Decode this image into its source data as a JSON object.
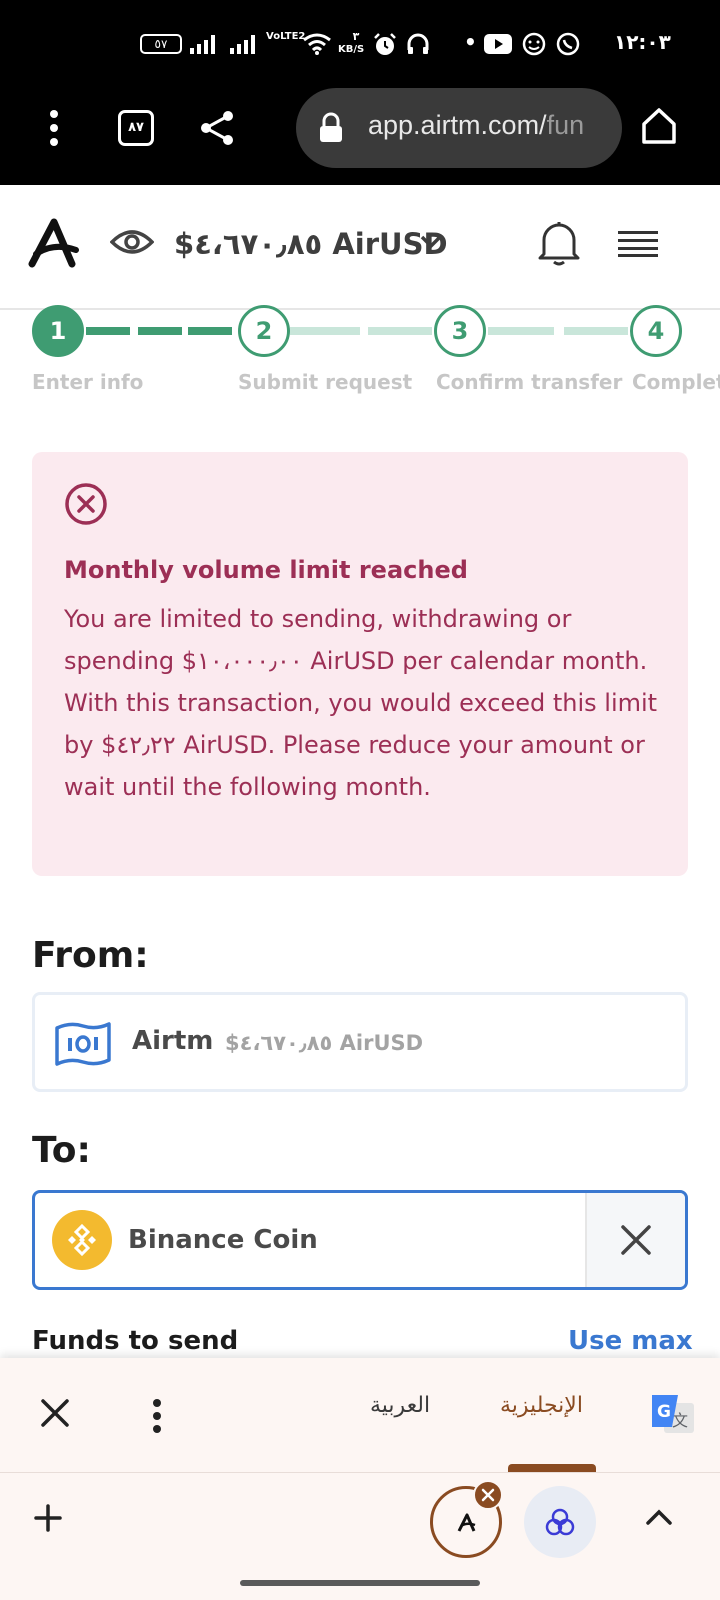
{
  "status_bar": {
    "battery": "٥٧",
    "network_label": "VoLTE2",
    "speed_value": "٣",
    "speed_unit": "KB/S",
    "time": "١٢:٠٣"
  },
  "browser": {
    "tab_count": "٨٧",
    "url_main": "app.airtm.com/",
    "url_faded": "fun"
  },
  "header": {
    "balance": "$٤،٦٧٠٫٨٥ AirUSD"
  },
  "stepper": {
    "steps": [
      {
        "number": "1",
        "label": "Enter info"
      },
      {
        "number": "2",
        "label": "Submit request"
      },
      {
        "number": "3",
        "label": "Confirm transfer"
      },
      {
        "number": "4",
        "label": "Complete"
      }
    ],
    "current_step": 1
  },
  "alert": {
    "title": "Monthly volume limit reached",
    "body": "You are limited to sending, withdrawing or spending $١٠،٠٠٠٫٠٠ AirUSD per calendar month. With this transaction, you would exceed this limit by $٤٢٫٢٢ AirUSD. Please reduce your amount or wait until the following month."
  },
  "from": {
    "label": "From:",
    "name": "Airtm",
    "balance": "$٤،٦٧٠٫٨٥ AirUSD"
  },
  "to": {
    "label": "To:",
    "name": "Binance Coin"
  },
  "funds": {
    "label": "Funds to send",
    "use_max": "Use max"
  },
  "translate": {
    "source_language": "العربية",
    "target_language": "الإنجليزية"
  },
  "colors": {
    "brand_green": "#3f9c72",
    "error_text": "#9c2f55",
    "error_bg": "#fbeaef",
    "link_blue": "#3a78d0",
    "translate_accent": "#8a4b21"
  }
}
